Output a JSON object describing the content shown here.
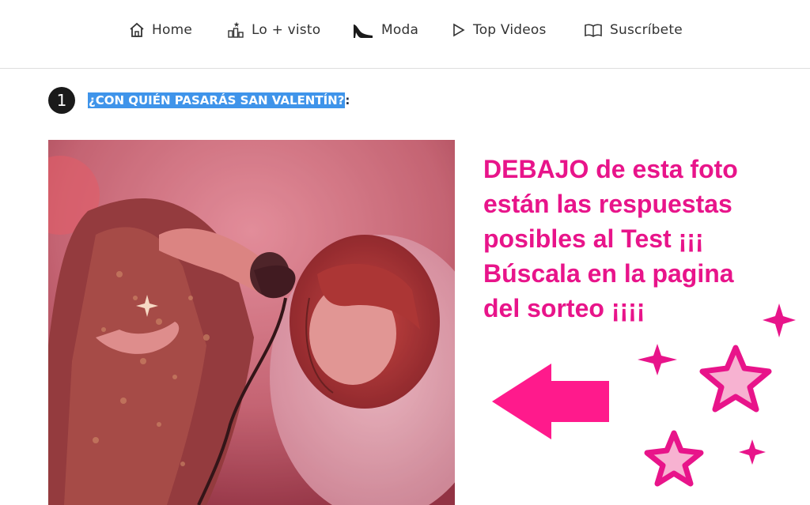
{
  "nav": {
    "items": [
      {
        "label": "Home",
        "icon": "home-icon"
      },
      {
        "label": "Lo + visto",
        "icon": "ranking-icon"
      },
      {
        "label": "Moda",
        "icon": "high-heel-icon"
      },
      {
        "label": "Top Videos",
        "icon": "play-icon"
      },
      {
        "label": "Suscríbete",
        "icon": "book-icon"
      }
    ]
  },
  "question": {
    "number": "1",
    "title": "¿CON QUIÉN PASARÁS SAN VALENTÍN?",
    "suffix": ":"
  },
  "overlay": {
    "text": " DEBAJO de esta foto\nestán las respuestas\nposibles al Test  ¡¡¡\nBúscala en la pagina\ndel sorteo ¡¡¡¡",
    "color": "#e8148a"
  },
  "colors": {
    "selection": "#3f94ea",
    "nav_text": "#333333",
    "photo_tint": "#c0425a"
  }
}
